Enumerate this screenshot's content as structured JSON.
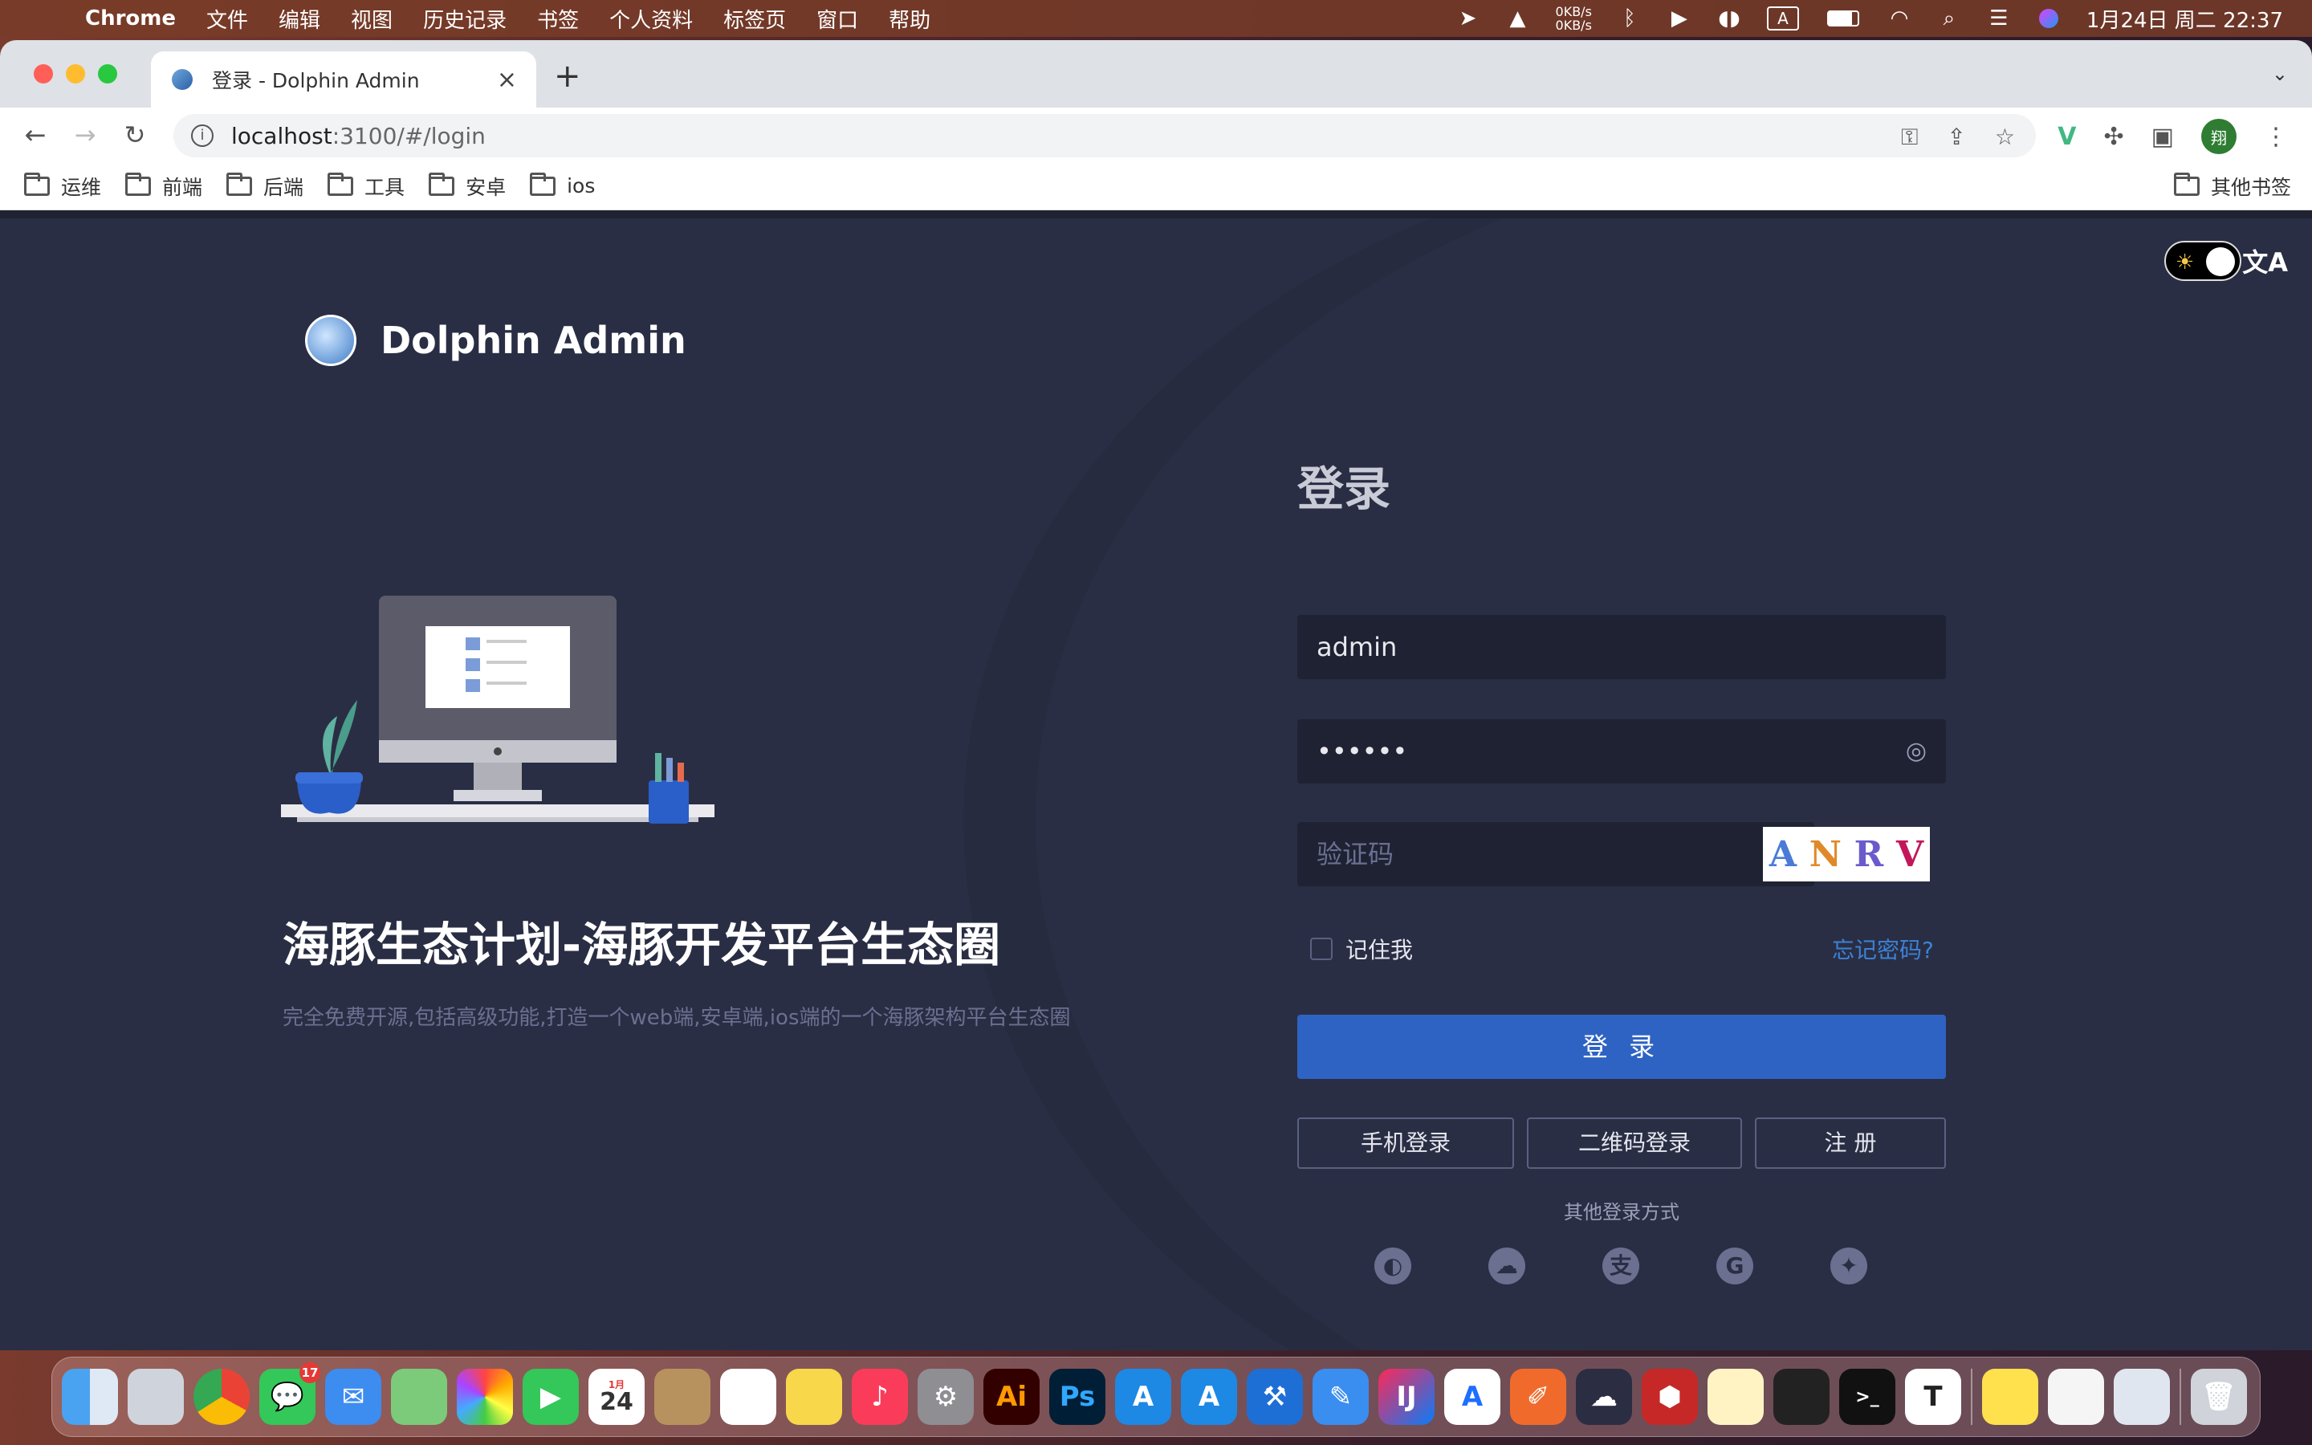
{
  "menubar": {
    "app_name": "Chrome",
    "items": [
      "文件",
      "编辑",
      "视图",
      "历史记录",
      "书签",
      "个人资料",
      "标签页",
      "窗口",
      "帮助"
    ],
    "net_up": "0KB/s",
    "net_down": "0KB/s",
    "input_method": "A",
    "datetime": "1月24日 周二  22:37"
  },
  "browser": {
    "tab_title": "登录 - Dolphin Admin",
    "url_host": "localhost",
    "url_path": ":3100/#/login",
    "profile_initial": "翔",
    "bookmarks": [
      "运维",
      "前端",
      "后端",
      "工具",
      "安卓",
      "ios"
    ],
    "other_bookmarks": "其他书签"
  },
  "page": {
    "brand_name": "Dolphin Admin",
    "hero_title": "海豚生态计划-海豚开发平台生态圈",
    "hero_subtitle": "完全免费开源,包括高级功能,打造一个web端,安卓端,ios端的一个海豚架构平台生态圈",
    "login_title": "登录",
    "username_value": "admin",
    "password_value": "••••••",
    "captcha_placeholder": "验证码",
    "captcha_chars": [
      "A",
      "N",
      "R",
      "V"
    ],
    "remember_label": "记住我",
    "forgot_label": "忘记密码?",
    "login_button": "登 录",
    "phone_login": "手机登录",
    "qr_login": "二维码登录",
    "register": "注 册",
    "other_methods": "其他登录方式",
    "social": [
      "github-icon",
      "wechat-icon",
      "alipay-icon",
      "google-icon",
      "twitter-icon"
    ]
  },
  "dock": {
    "messages_badge": "17",
    "calendar_month": "1月",
    "calendar_day": "24"
  }
}
